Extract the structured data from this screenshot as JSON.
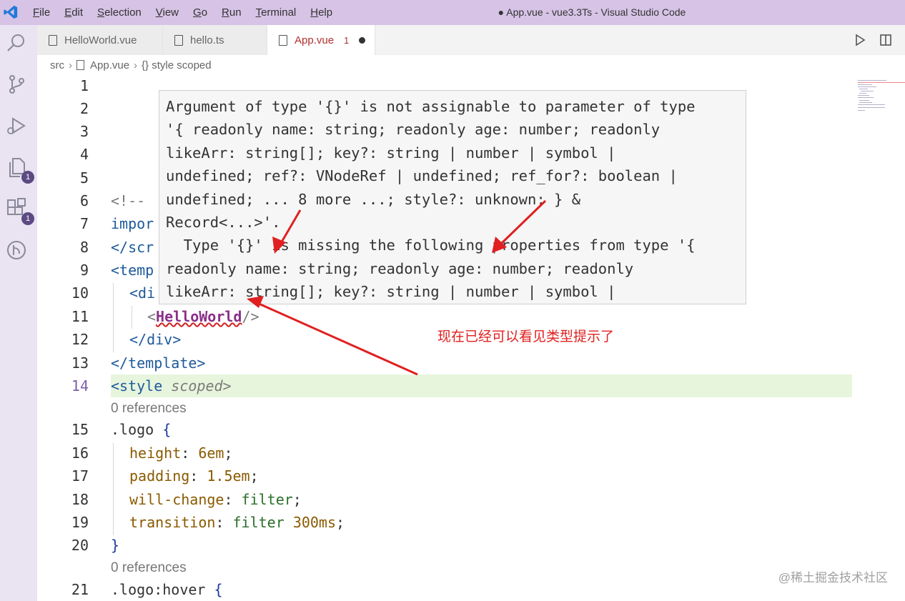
{
  "titlebar": {
    "menu": [
      "File",
      "Edit",
      "Selection",
      "View",
      "Go",
      "Run",
      "Terminal",
      "Help"
    ],
    "window_title": "● App.vue - vue3.3Ts - Visual Studio Code"
  },
  "activity_bar": {
    "items": [
      {
        "icon": "search-icon"
      },
      {
        "icon": "source-control-icon"
      },
      {
        "icon": "run-debug-icon"
      },
      {
        "icon": "explorer-icon",
        "badge": "1"
      },
      {
        "icon": "extensions-icon",
        "badge": "1"
      },
      {
        "icon": "remote-icon"
      }
    ]
  },
  "tabs": [
    {
      "label": "HelloWorld.vue",
      "active": false
    },
    {
      "label": "hello.ts",
      "active": false
    },
    {
      "label": "App.vue",
      "active": true,
      "problems": "1",
      "modified": true
    }
  ],
  "breadcrumb": {
    "root": "src",
    "file": "App.vue",
    "symbol": "{} style scoped"
  },
  "editor": {
    "line_numbers": [
      "1",
      "2",
      "3",
      "4",
      "5",
      "6",
      "7",
      "8",
      "9",
      "10",
      "11",
      "12",
      "13",
      "14",
      "15",
      "16",
      "17",
      "18",
      "19",
      "20",
      "21"
    ],
    "lines": {
      "l6": "<!--",
      "l7": "impor",
      "l8": "</scr",
      "l9": "<temp",
      "l10": "<di",
      "l11_open": "<",
      "l11_comp": "HelloWorld",
      "l11_close": "/>",
      "l12": "</div>",
      "l13": "</template>",
      "l14_open": "<style",
      "l14_attr": "scoped",
      "l14_close": ">",
      "ref1": "0 references",
      "l15_sel": ".logo",
      "l15_brace": "{",
      "l16_prop": "height",
      "l16_val": "6em",
      "l17_prop": "padding",
      "l17_val": "1.5em",
      "l18_prop": "will-change",
      "l18_val": "filter",
      "l19_prop": "transition",
      "l19_val1": "filter",
      "l19_val2": "300ms",
      "l20": "}",
      "ref2": "0 references",
      "l21_sel": ".logo:hover",
      "l21_brace": "{"
    }
  },
  "hover_tooltip": {
    "lines": [
      "Argument of type '{}' is not assignable to parameter of type",
      "'{ readonly name: string; readonly age: number; readonly",
      "likeArr: string[]; key?: string | number | symbol |",
      "undefined; ref?: VNodeRef | undefined; ref_for?: boolean |",
      "undefined; ... 8 more ...; style?: unknown; } &",
      "Record<...>'.",
      "  Type '{}' is missing the following properties from type '{",
      "readonly name: string; readonly age: number; readonly",
      "likeArr: string[]; key?: string | number | symbol |"
    ]
  },
  "annotation": "现在已经可以看见类型提示了",
  "watermark": "@稀土掘金技术社区",
  "colors": {
    "titlebar": "#d6c3e6",
    "activity_bar": "#e9e3f2",
    "arrow": "#e02020",
    "current_line": "#e7f5dd"
  }
}
